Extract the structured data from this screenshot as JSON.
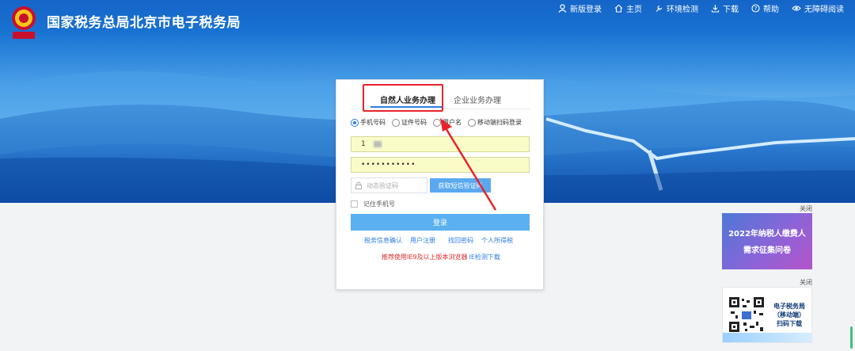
{
  "header": {
    "title": "国家税务总局北京市电子税务局",
    "logo_text": "中国税务",
    "nav": [
      {
        "label": "新版登录",
        "icon": "user-icon"
      },
      {
        "label": "主页",
        "icon": "home-icon"
      },
      {
        "label": "环境检测",
        "icon": "wrench-icon"
      },
      {
        "label": "下载",
        "icon": "download-icon"
      },
      {
        "label": "帮助",
        "icon": "help-icon"
      },
      {
        "label": "无障碍阅读",
        "icon": "eye-icon"
      }
    ]
  },
  "login": {
    "tabs": [
      {
        "label": "自然人业务办理",
        "active": true
      },
      {
        "label": "企业业务办理",
        "active": false
      }
    ],
    "login_methods": [
      {
        "label": "手机号码",
        "selected": true
      },
      {
        "label": "证件号码",
        "selected": false
      },
      {
        "label": "用户名",
        "selected": false
      },
      {
        "label": "移动端扫码登录",
        "selected": false
      }
    ],
    "phone_value": "1",
    "password_value": "•••••••••••",
    "sms_placeholder": "动态验证码",
    "sms_button": "获取短信验证码",
    "remember_label": "记住手机号",
    "login_button": "登录",
    "links": [
      "税务信息确认",
      "用户注册",
      "找回密码",
      "个人所得税"
    ],
    "recommend_text": "推荐使用IE9及以上版本浏览器",
    "recommend_link": "IE检测下载"
  },
  "ads": {
    "close_label": "关闭",
    "survey_line1": "2022年纳税人缴费人",
    "survey_line2": "需求征集问卷",
    "app_line1": "电子税务局",
    "app_line2": "（移动端）",
    "app_line3": "扫码下载"
  },
  "colors": {
    "accent": "#2a7ee0",
    "annotation": "#e8222b",
    "input_autofill": "#fafcc8"
  }
}
